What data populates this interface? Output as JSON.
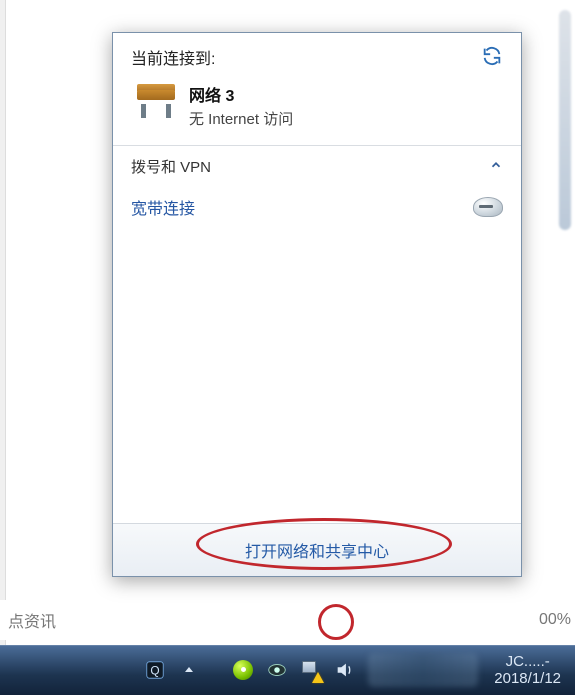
{
  "flyout": {
    "header": {
      "title": "当前连接到:"
    },
    "network": {
      "name": "网络  3",
      "status": "无 Internet 访问"
    },
    "dial_section": {
      "label": "拨号和 VPN"
    },
    "connection": {
      "label": "宽带连接"
    },
    "footer": {
      "open_center": "打开网络和共享中心"
    }
  },
  "bottom_bar": {
    "left_text": "点资讯",
    "zoom": "00%"
  },
  "taskbar": {
    "clock": {
      "time": "JC.....-",
      "date": "2018/1/12"
    },
    "tray": {
      "icons": [
        "q-icon",
        "expand-icon",
        "ball-icon",
        "eye-icon",
        "network-icon",
        "volume-icon"
      ]
    }
  }
}
